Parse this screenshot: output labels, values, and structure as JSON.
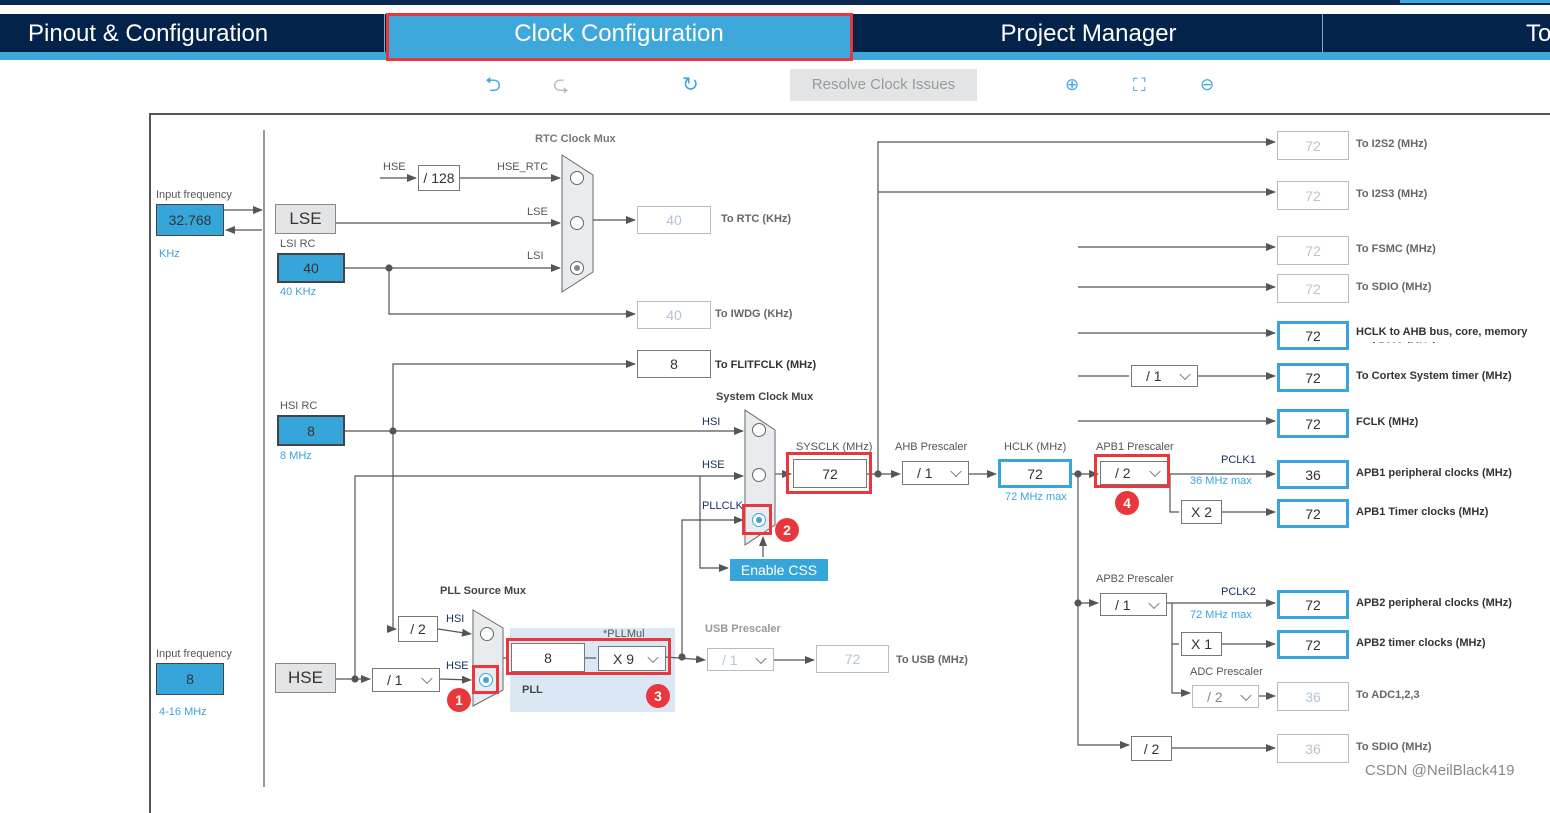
{
  "tabs": [
    {
      "label": "Pinout & Configuration"
    },
    {
      "label": "Clock Configuration",
      "active": true
    },
    {
      "label": "Project Manager"
    },
    {
      "label": "To"
    }
  ],
  "toolbar": {
    "undo_icon": "undo-icon",
    "redo_icon": "redo-icon",
    "reset_icon": "refresh-icon",
    "resolve_label": "Resolve Clock Issues",
    "zoom_in_icon": "zoom-in-icon",
    "fit_icon": "fit-screen-icon",
    "zoom_out_icon": "zoom-out-icon"
  },
  "lse": {
    "label_input": "Input frequency",
    "value": "32.768",
    "unit": "KHz",
    "block": "LSE"
  },
  "lsi": {
    "label": "LSI RC",
    "value": "40",
    "unit": "40 KHz"
  },
  "hsi": {
    "label": "HSI RC",
    "value": "8",
    "unit": "8 MHz"
  },
  "hse": {
    "label_input": "Input frequency",
    "value": "8",
    "unit": "4-16 MHz",
    "block": "HSE"
  },
  "rtc": {
    "title": "RTC Clock Mux",
    "hse": "HSE",
    "div": "/ 128",
    "hse_rtc": "HSE_RTC",
    "lse": "LSE",
    "lsi": "LSI",
    "rtc_value": "40",
    "rtc_label": "To RTC (KHz)",
    "iwdg_value": "40",
    "iwdg_label": "To IWDG (KHz)"
  },
  "flit": {
    "value": "8",
    "label": "To FLITFCLK (MHz)"
  },
  "sysmux": {
    "title": "System Clock Mux",
    "hsi": "HSI",
    "hse": "HSE",
    "pllclk": "PLLCLK",
    "enable_css": "Enable CSS"
  },
  "sysclk": {
    "label": "SYSCLK (MHz)",
    "value": "72"
  },
  "ahb": {
    "label": "AHB Prescaler",
    "value": "/ 1"
  },
  "hclk": {
    "label": "HCLK (MHz)",
    "value": "72",
    "max": "72 MHz max"
  },
  "apb1": {
    "label": "APB1 Prescaler",
    "value": "/ 2",
    "pclk": "PCLK1",
    "max": "36 MHz max",
    "timer_mul": "X 2"
  },
  "apb2": {
    "label": "APB2 Prescaler",
    "value": "/ 1",
    "pclk": "PCLK2",
    "max": "72 MHz max",
    "timer_mul": "X 1"
  },
  "adc": {
    "label": "ADC Prescaler",
    "value": "/ 2"
  },
  "cortex_div": "/ 1",
  "sdio_div": "/ 2",
  "pllsrc": {
    "title": "PLL Source Mux",
    "div": "/ 2",
    "hsi": "HSI",
    "hse": "HSE",
    "hse_div": "/ 1"
  },
  "pll": {
    "label": "PLL",
    "mul_label": "*PLLMul",
    "input": "8",
    "mul": "X 9"
  },
  "usb": {
    "label": "USB Prescaler",
    "div": "/ 1",
    "value": "72",
    "out": "To USB (MHz)"
  },
  "outputs": [
    {
      "value": "72",
      "label": "To I2S2 (MHz)",
      "enabled": false
    },
    {
      "value": "72",
      "label": "To I2S3 (MHz)",
      "enabled": false
    },
    {
      "value": "72",
      "label": "To FSMC (MHz)",
      "enabled": false
    },
    {
      "value": "72",
      "label": "To SDIO (MHz)",
      "enabled": false
    },
    {
      "value": "72",
      "label": "HCLK to AHB bus, core, memory and DMA (MHz)",
      "enabled": true
    },
    {
      "value": "72",
      "label": "To Cortex System timer (MHz)",
      "enabled": true
    },
    {
      "value": "72",
      "label": "FCLK (MHz)",
      "enabled": true
    },
    {
      "value": "36",
      "label": "APB1 peripheral clocks (MHz)",
      "enabled": true
    },
    {
      "value": "72",
      "label": "APB1 Timer clocks (MHz)",
      "enabled": true
    },
    {
      "value": "72",
      "label": "APB2 peripheral clocks (MHz)",
      "enabled": true
    },
    {
      "value": "72",
      "label": "APB2 timer clocks (MHz)",
      "enabled": true
    },
    {
      "value": "36",
      "label": "To ADC1,2,3",
      "enabled": false
    },
    {
      "value": "36",
      "label": "To SDIO (MHz)",
      "enabled": false
    }
  ],
  "badges": [
    "1",
    "2",
    "3",
    "4"
  ],
  "watermark": "CSDN @NeilBlack419",
  "colors": {
    "navy": "#03234b",
    "accent": "#3ea8dc",
    "highlight": "#e8383d"
  }
}
